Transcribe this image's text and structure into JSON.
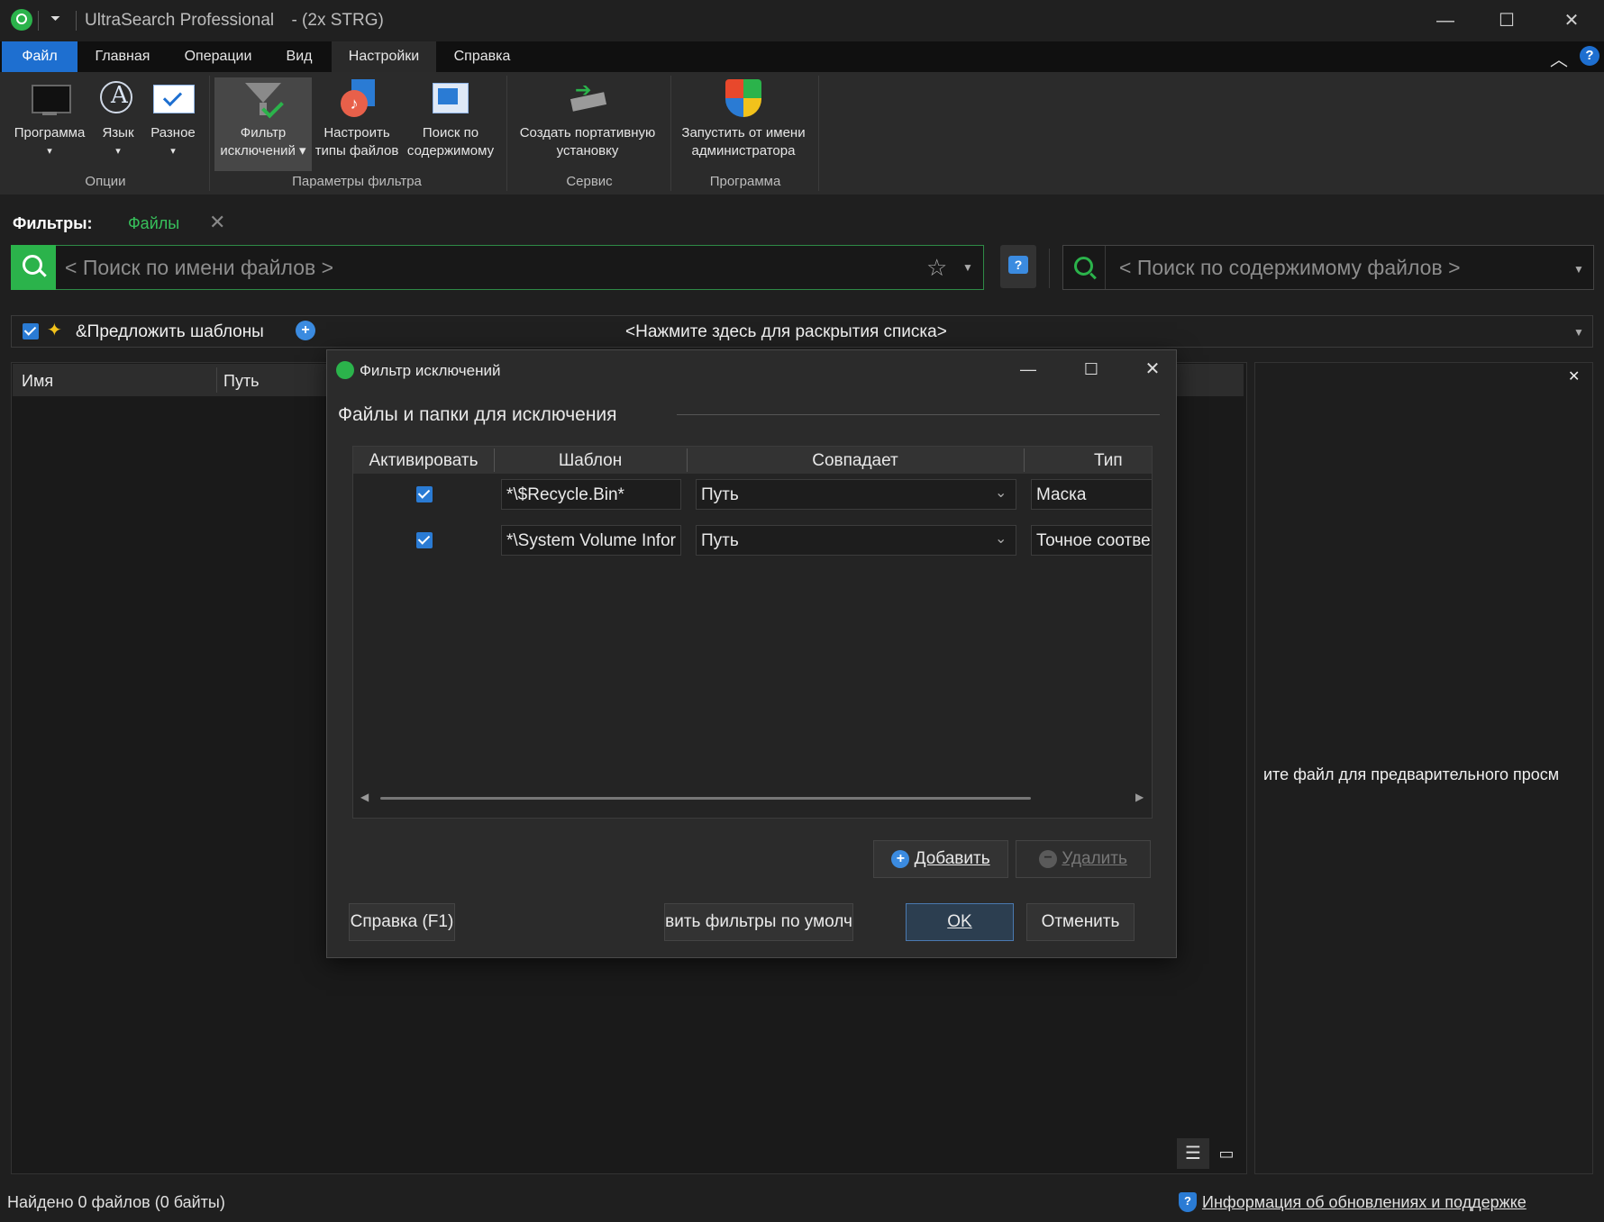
{
  "window": {
    "title": "UltraSearch Professional",
    "title_suffix": "-   (2x STRG)"
  },
  "tabs": [
    "Файл",
    "Главная",
    "Операции",
    "Вид",
    "Настройки",
    "Справка"
  ],
  "ribbon": {
    "buttons": [
      {
        "label1": "Программа",
        "label2": "▾"
      },
      {
        "label1": "Язык",
        "label2": "▾"
      },
      {
        "label1": "Разное",
        "label2": "▾"
      },
      {
        "label1": "Фильтр",
        "label2": "исключений ▾"
      },
      {
        "label1": "Настроить",
        "label2": "типы файлов"
      },
      {
        "label1": "Поиск по",
        "label2": "содержимому"
      },
      {
        "label1": "Создать портативную",
        "label2": "установку"
      },
      {
        "label1": "Запустить от имени",
        "label2": "администратора"
      }
    ],
    "groups": [
      "Опции",
      "Параметры фильтра",
      "Сервис",
      "Программа"
    ]
  },
  "filters": {
    "label": "Фильтры:",
    "tag": "Файлы",
    "close": "✕"
  },
  "search": {
    "name_placeholder": "< Поиск по имени файлов >",
    "content_placeholder": "< Поиск по содержимому файлов >"
  },
  "suggest": {
    "label": "&Предложить шаблоны",
    "expand": "<Нажмите здесь для раскрытия списка>"
  },
  "results": {
    "columns": [
      "Имя",
      "Путь"
    ]
  },
  "preview": {
    "message": "ите файл для предварительного просм"
  },
  "dialog": {
    "title": "Фильтр исключений",
    "section": "Файлы и папки для исключения",
    "columns": [
      "Активировать",
      "Шаблон",
      "Совпадает",
      "Тип"
    ],
    "rows": [
      {
        "pattern": "*\\$Recycle.Bin*",
        "match": "Путь",
        "type": "Маска"
      },
      {
        "pattern": "*\\System Volume Infor",
        "match": "Путь",
        "type": "Точное соотве"
      }
    ],
    "add": "Добавить",
    "remove": "Удалить",
    "help": "Справка (F1)",
    "defaults": "вить фильтры по умолч",
    "ok": "OK",
    "cancel": "Отменить"
  },
  "status": {
    "found": "Найдено 0 файлов (0 байты)",
    "updates": "Информация об обновлениях и поддержке"
  },
  "colors": {
    "accent": "#1e6fd0",
    "green": "#2bb34b"
  }
}
